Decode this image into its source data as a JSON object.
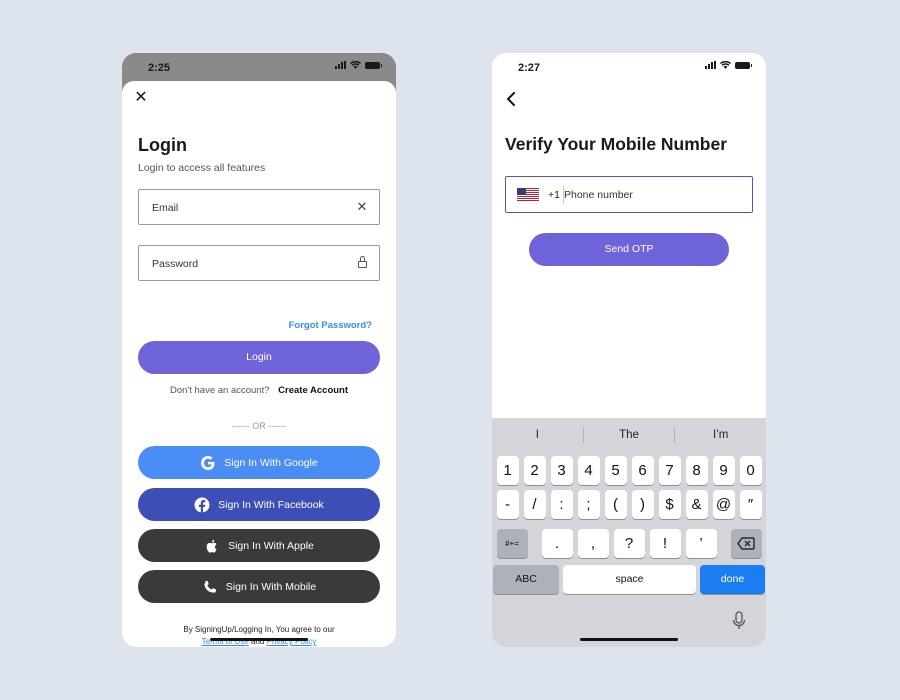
{
  "login_screen": {
    "status_time": "2:25",
    "close_icon": "close-icon",
    "title": "Login",
    "subtitle": "Login to access all features",
    "email_placeholder": "Email",
    "password_placeholder": "Password",
    "forgot_password": "Forgot Password?",
    "login_button": "Login",
    "no_account_text": "Don't have an account?",
    "create_account": "Create Account",
    "or_divider": "------ OR ------",
    "social_buttons": [
      {
        "label": "Sign In With Google",
        "icon": "google-icon",
        "color": "#4a8df5"
      },
      {
        "label": "Sign In With Facebook",
        "icon": "facebook-icon",
        "color": "#3d4fb6"
      },
      {
        "label": "Sign In With Apple",
        "icon": "apple-icon",
        "color": "#3a3a3a"
      },
      {
        "label": "Sign In With Mobile",
        "icon": "phone-icon",
        "color": "#3a3a3a"
      }
    ],
    "terms_prefix": "By SigningUp/Logging In, You agree to our",
    "terms_link": "Terms of Use",
    "terms_and": "and",
    "privacy_link": "Privacy Policy",
    "accent_color": "#6e63d9",
    "link_color": "#3a8ae8"
  },
  "verify_screen": {
    "status_time": "2:27",
    "back_icon": "chevron-left-icon",
    "title": "Verify Your Mobile Number",
    "country_code": "+1",
    "phone_placeholder": "Phone number",
    "send_otp_button": "Send OTP",
    "keyboard": {
      "suggestions": [
        "I",
        "The",
        "I’m"
      ],
      "row1": [
        "1",
        "2",
        "3",
        "4",
        "5",
        "6",
        "7",
        "8",
        "9",
        "0"
      ],
      "row2": [
        "-",
        "/",
        ":",
        ";",
        "(",
        ")",
        "$",
        "&",
        "@",
        "″"
      ],
      "row3": [
        ".",
        ",",
        "?",
        "!",
        "’"
      ],
      "symbols_key": "#+=",
      "abc_key": "ABC",
      "space_key": "space",
      "done_key": "done"
    }
  }
}
